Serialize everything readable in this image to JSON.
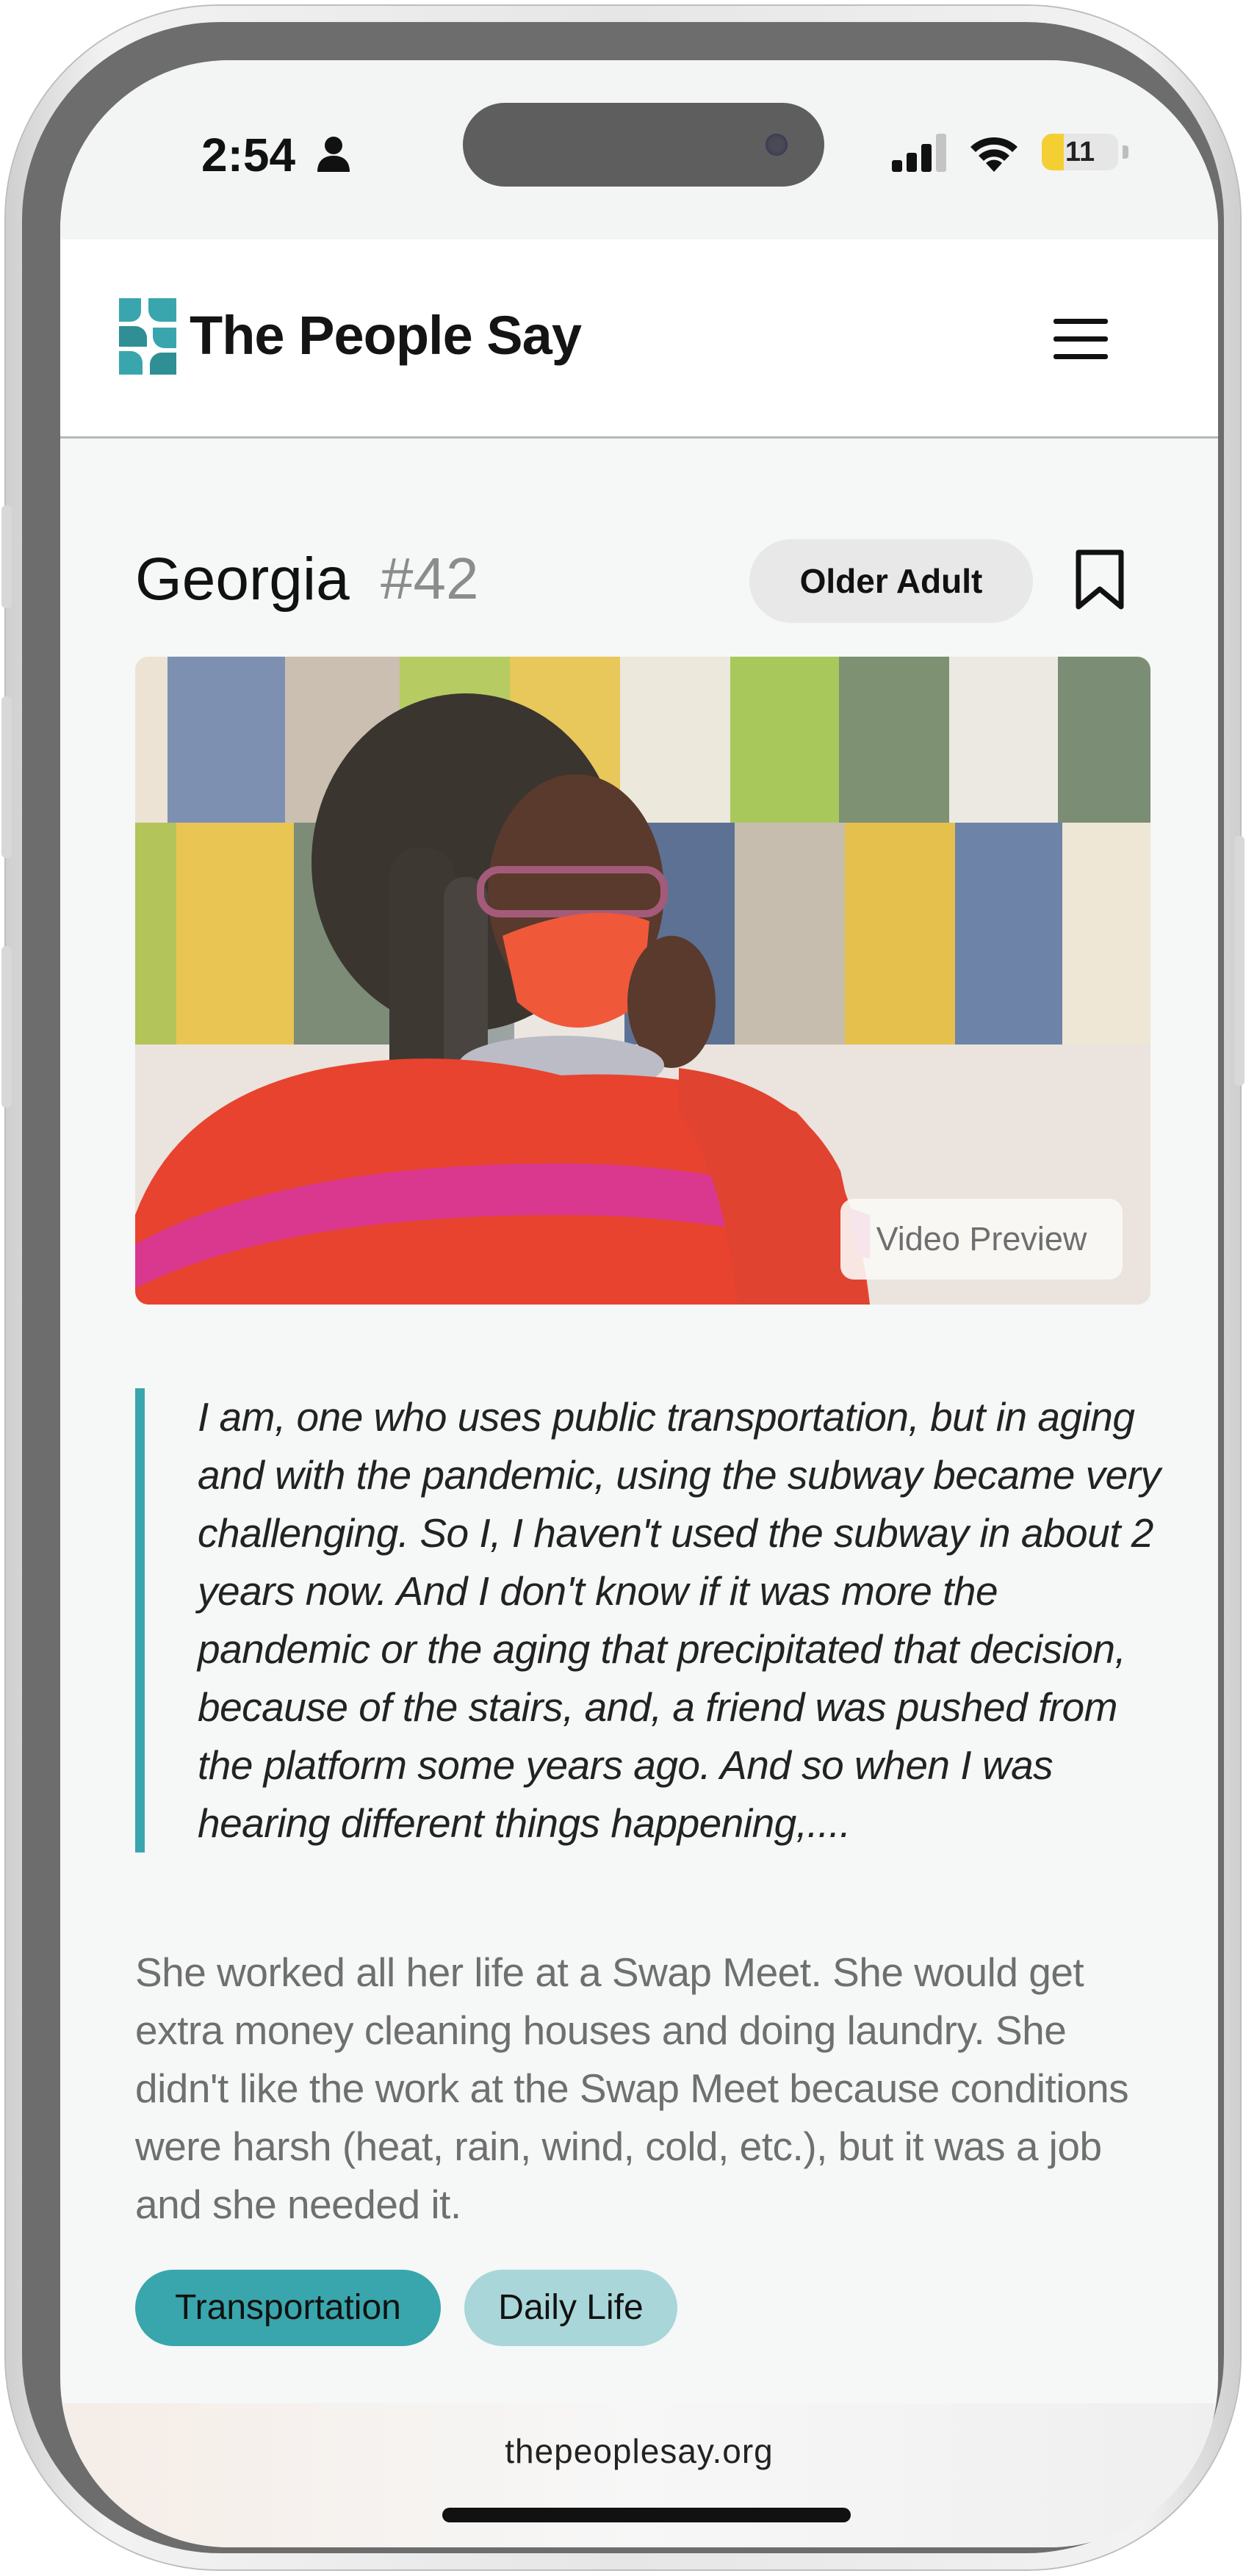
{
  "status_bar": {
    "time": "2:54",
    "battery_level": "11",
    "battery_fraction": 0.11
  },
  "header": {
    "brand": "The People Say",
    "menu_icon": "hamburger-menu-icon",
    "logo_color": "#39a6ad"
  },
  "profile": {
    "name": "Georgia",
    "number": "#42",
    "badge": "Older Adult",
    "bookmark_icon": "bookmark-icon"
  },
  "video": {
    "preview_label": "Video Preview"
  },
  "quote": "I am, one who uses public transportation, but in aging and with the pandemic, using the subway became very challenging. So I, I haven't used the subway in about 2 years now. And I don't know if it was more the pandemic or the aging that precipitated that decision, because of the stairs, and, a friend was pushed from the platform some years ago. And so when I was hearing different things happening,....",
  "description": "She worked all her life at a Swap Meet. She would get extra money cleaning houses and doing laundry. She didn't like the work at the Swap Meet because conditions were harsh (heat, rain, wind, cold, etc.), but it was a job and she needed it.",
  "tags": [
    "Transportation",
    "Daily Life"
  ],
  "browser": {
    "url": "thepeoplesay.org"
  },
  "colors": {
    "accent": "#39a6ad",
    "accent_light": "#a9d6d9",
    "badge_bg": "#e8e8e8"
  }
}
